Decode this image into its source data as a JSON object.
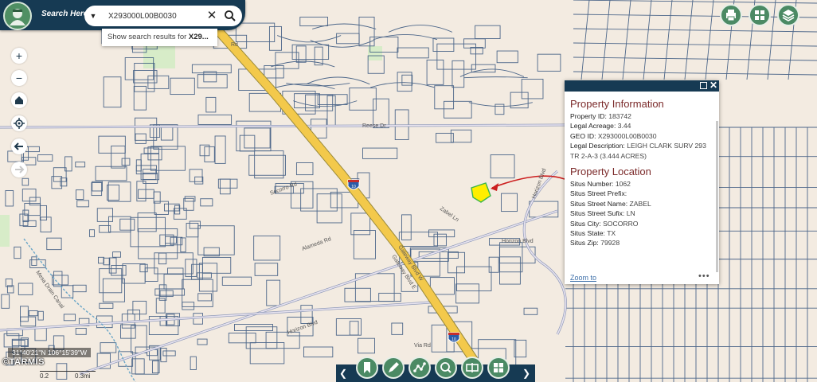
{
  "search": {
    "label": "Search Here:",
    "value": "X293000L00B0030",
    "suggestion_prefix": "Show search results for ",
    "suggestion_term": "X29..."
  },
  "map_labels": [
    "Horizon Blvd",
    "Horizon Blvd",
    "Gateway Blvd W",
    "Gateway Blvd E",
    "Socorro Rd",
    "Alameda Rd",
    "Mesa Drain Canal",
    "Zabel Ln",
    "Reese Dr",
    "Rd",
    "Via Rd",
    "Horizon Blvd"
  ],
  "shields": [
    "10",
    "10"
  ],
  "popup": {
    "section1_title": "Property Information",
    "fields1": [
      {
        "label": "Property ID:",
        "value": "183742"
      },
      {
        "label": "Legal Acreage:",
        "value": "3.44"
      },
      {
        "label": "GEO ID:",
        "value": "X293000L00B0030"
      },
      {
        "label": "Legal Description:",
        "value": "LEIGH CLARK SURV 293 TR 2-A-3 (3.444 ACRES)"
      }
    ],
    "section2_title": "Property Location",
    "fields2": [
      {
        "label": "Situs Number:",
        "value": "1062"
      },
      {
        "label": "Situs Street Prefix:",
        "value": ""
      },
      {
        "label": "Situs Street Name:",
        "value": "ZABEL"
      },
      {
        "label": "Situs Street Sufix:",
        "value": "LN"
      },
      {
        "label": "Situs City:",
        "value": "SOCORRO"
      },
      {
        "label": "Situs State:",
        "value": "TX"
      },
      {
        "label": "Situs Zip:",
        "value": "79928"
      }
    ],
    "zoom_label": "Zoom to",
    "more_label": "•••"
  },
  "coords": "31°40'21\"N 106°15'39\"W",
  "scale": {
    "left": "0.2",
    "right": "0.3mi"
  },
  "brand": "©TARMIS",
  "colors": {
    "header": "#163a53",
    "button_green": "#4b8a64",
    "highway": "#f3c94b",
    "parcel_line": "#2f4f7a",
    "highlight": "#ffee00",
    "arrow": "#cc1f1f",
    "title_red": "#7b2a2a"
  },
  "icons": {
    "map_tools": [
      "plus-icon",
      "minus-icon",
      "home-icon",
      "locate-icon",
      "back-arrow-icon",
      "forward-arrow-icon"
    ],
    "right_tools": [
      "print-icon",
      "basemap-grid-icon",
      "layers-icon"
    ],
    "bottom_tools": [
      "bookmark-icon",
      "draw-icon",
      "measure-icon",
      "zoom-search-icon",
      "swipe-icon",
      "select-parcel-icon"
    ]
  }
}
